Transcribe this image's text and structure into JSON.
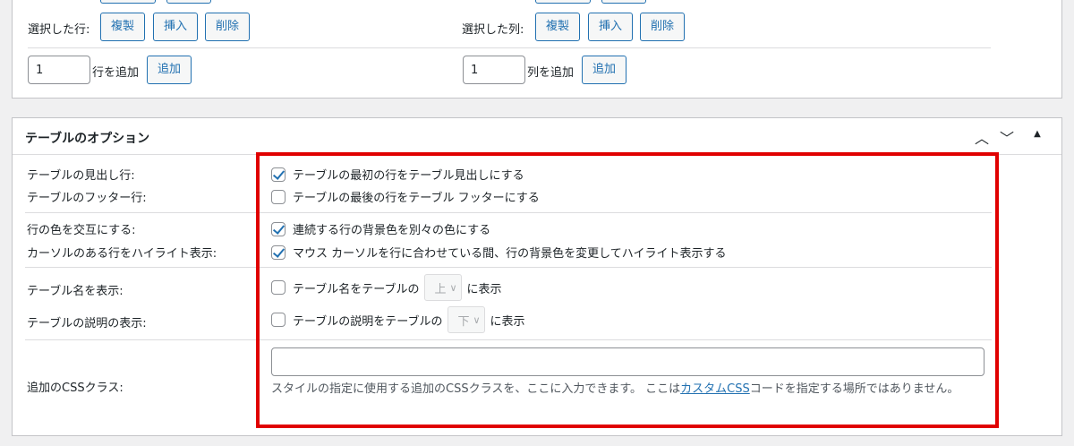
{
  "top_panel": {
    "row_ops": {
      "label": "選択した行:",
      "duplicate": "複製",
      "insert": "挿入",
      "delete": "削除"
    },
    "col_ops": {
      "label": "選択した列:",
      "duplicate": "複製",
      "insert": "挿入",
      "delete": "削除"
    },
    "add_rows": {
      "value": "1",
      "label": "行を追加",
      "button": "追加"
    },
    "add_cols": {
      "value": "1",
      "label": "列を追加",
      "button": "追加"
    }
  },
  "options_panel": {
    "title": "テーブルのオプション",
    "controls": {
      "up": "⌃",
      "down": "⌄",
      "toggle": "▲"
    },
    "rows": {
      "header_label": "テーブルの見出し行:",
      "header_text": "テーブルの最初の行をテーブル見出しにする",
      "header_checked": true,
      "footer_label": "テーブルのフッター行:",
      "footer_text": "テーブルの最後の行をテーブル フッターにする",
      "footer_checked": false,
      "alt_label": "行の色を交互にする:",
      "alt_text": "連続する行の背景色を別々の色にする",
      "alt_checked": true,
      "hover_label": "カーソルのある行をハイライト表示:",
      "hover_text": "マウス カーソルを行に合わせている間、行の背景色を変更してハイライト表示する",
      "hover_checked": true,
      "name_label": "テーブル名を表示:",
      "name_text_before": "テーブル名をテーブルの",
      "name_select": "上",
      "name_text_after": "に表示",
      "name_checked": false,
      "desc_label": "テーブルの説明の表示:",
      "desc_text_before": "テーブルの説明をテーブルの",
      "desc_select": "下",
      "desc_text_after": "に表示",
      "desc_checked": false,
      "css_label": "追加のCSSクラス:",
      "css_value": "",
      "css_help_before": "スタイルの指定に使用する追加のCSSクラスを、ここに入力できます。 ここは",
      "css_help_link": "カスタムCSS",
      "css_help_after": "コードを指定する場所ではありません。"
    }
  },
  "colors": {
    "accent": "#2271b1",
    "highlight": "#e00000",
    "background": "#f0f0f1"
  }
}
